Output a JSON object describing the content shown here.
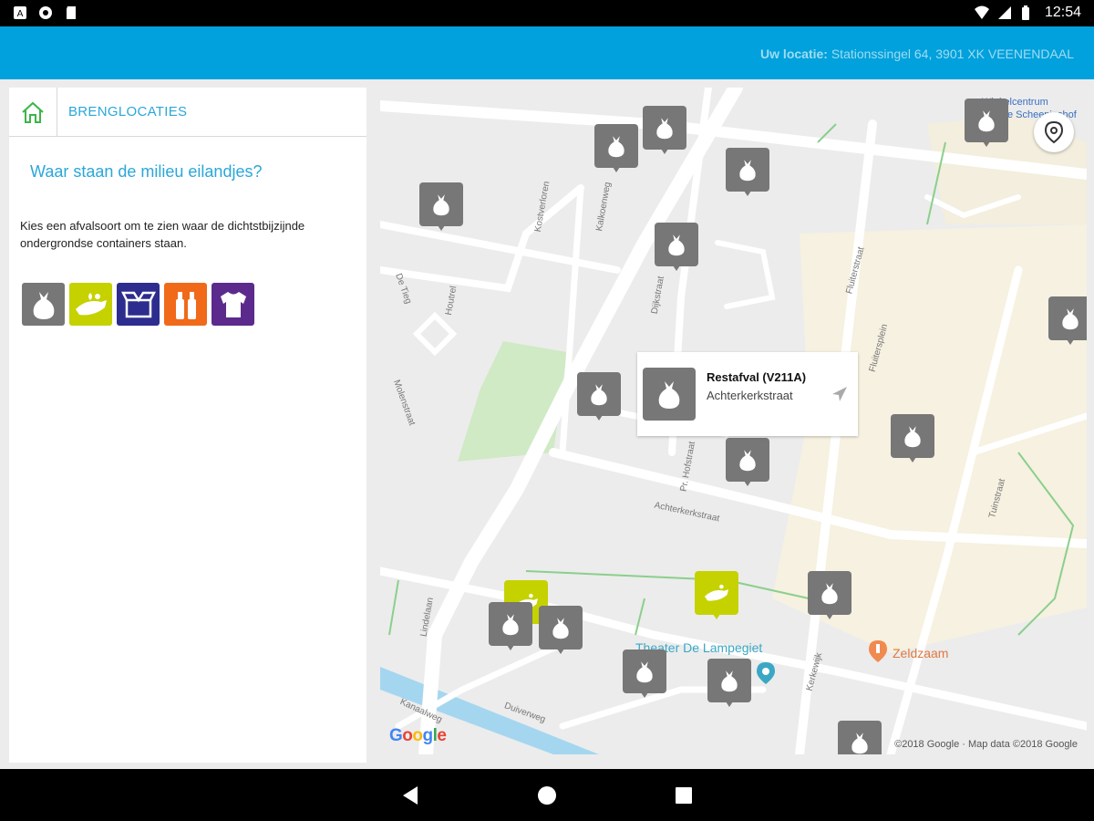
{
  "status_bar": {
    "time": "12:54",
    "icons": [
      "notification-a-icon",
      "sync-icon",
      "sd-card-icon",
      "wifi-icon",
      "signal-icon",
      "battery-icon"
    ]
  },
  "app_bar": {
    "location_label": "Uw locatie:",
    "location_value": "Stationssingel 64, 3901 XK VEENENDAAL"
  },
  "left_panel": {
    "breadcrumb_title": "BRENGLOCATIES",
    "heading": "Waar staan de milieu eilandjes?",
    "intro": "Kies een afvalsoort om te zien waar de dichtstbijzijnde ondergrondse containers staan.",
    "waste_types": [
      {
        "name": "restafval",
        "icon": "trash-bag-icon",
        "color": "#777777"
      },
      {
        "name": "gft",
        "icon": "organic-waste-icon",
        "color": "#c5d200"
      },
      {
        "name": "papier",
        "icon": "paper-box-icon",
        "color": "#2d2d8f"
      },
      {
        "name": "plastic",
        "icon": "bottles-icon",
        "color": "#f06a1a"
      },
      {
        "name": "textiel",
        "icon": "shirt-icon",
        "color": "#5c2a8c"
      }
    ]
  },
  "map": {
    "info_window": {
      "title": "Restafval (V211A)",
      "subtitle": "Achterkerkstraat"
    },
    "streets": [
      "De Tieg",
      "Houtrel",
      "Kostverloren",
      "Kalkoenweg",
      "Dijkstraat",
      "Molenstraat",
      "Pr. Hofstraat",
      "Achterkerkstraat",
      "Fluiterstraat",
      "Tuinstraat",
      "Lindelaan",
      "Kerkewijk",
      "Duiverweg",
      "Kanaalweg",
      "Fluitersplein"
    ],
    "pois": {
      "theater": "Theater De Lampegiet",
      "restaurant": "Zeldzaam",
      "shopping_center_line1": "Winkelcentrum",
      "shopping_center_line2": "De Scheepjeshof"
    },
    "colors": {
      "restafval": "#777777",
      "gft": "#c5d200",
      "theater_text": "#3aa8c4",
      "restaurant_text": "#e07840"
    },
    "google_logo": "Google",
    "copyright": "©2018 Google · Map data ©2018 Google"
  },
  "nav_bar": {
    "buttons": [
      "back-icon",
      "home-icon",
      "recents-icon"
    ]
  }
}
